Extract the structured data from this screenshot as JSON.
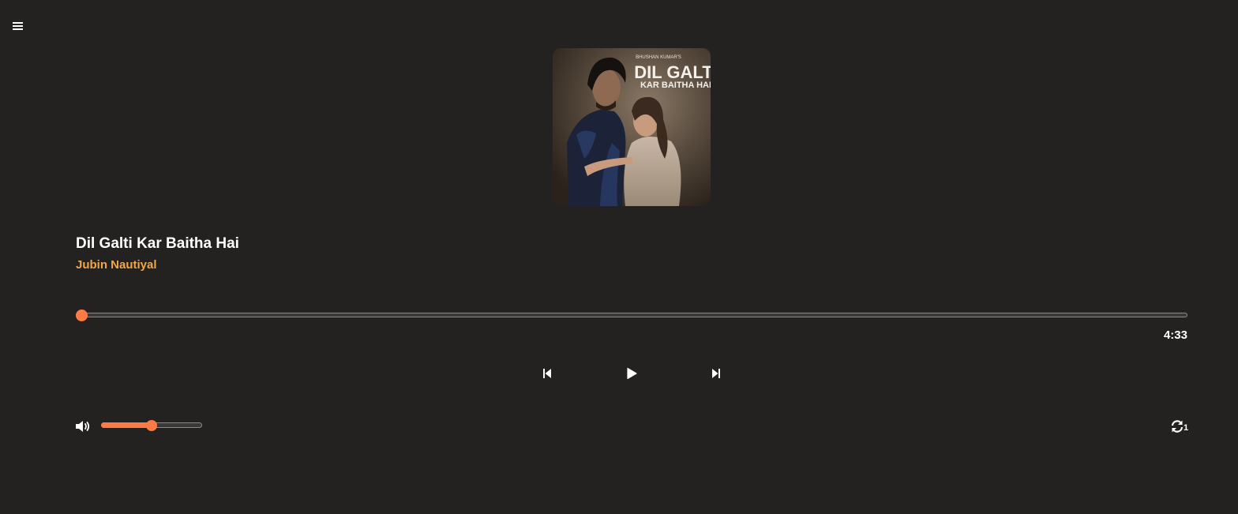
{
  "app": {
    "menu_icon": "hamburger-menu-icon"
  },
  "track": {
    "title": "Dil Galti Kar Baitha Hai",
    "artist": "Jubin Nautiyal",
    "duration": "4:33",
    "progress_fraction": 0.0,
    "cover": {
      "label_top": "BHUSHAN KUMAR'S",
      "label_main": "DIL GALTI",
      "label_sub": "KAR BAITHA HAI"
    }
  },
  "controls": {
    "prev_icon": "skip-previous-icon",
    "play_icon": "play-icon",
    "next_icon": "skip-next-icon"
  },
  "volume": {
    "icon": "volume-high-icon",
    "level_fraction": 0.5
  },
  "repeat": {
    "icon": "repeat-icon",
    "mode_label": "1"
  },
  "colors": {
    "background": "#232220",
    "accent": "#ff7a45",
    "artist": "#f2a64a",
    "text": "#ffffff"
  }
}
